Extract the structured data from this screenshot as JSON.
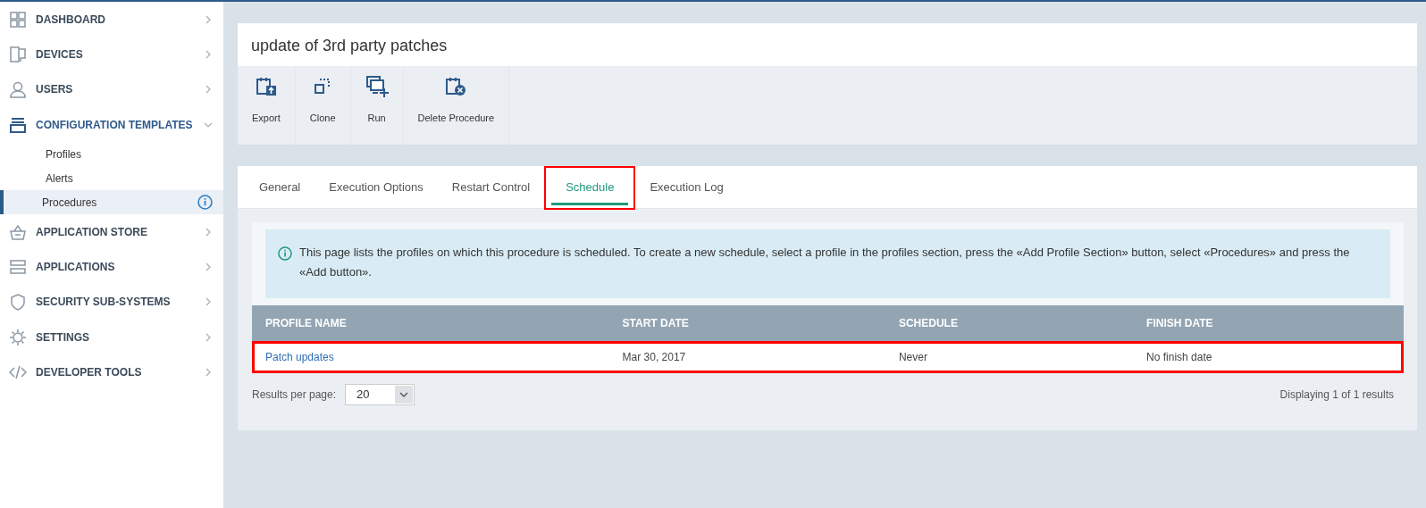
{
  "sidebar": {
    "items": [
      {
        "label": "DASHBOARD",
        "kind": "grid",
        "expanded": false
      },
      {
        "label": "DEVICES",
        "kind": "devices",
        "expanded": false
      },
      {
        "label": "USERS",
        "kind": "user",
        "expanded": false
      },
      {
        "label": "CONFIGURATION TEMPLATES",
        "kind": "templates",
        "expanded": true,
        "children": [
          {
            "label": "Profiles",
            "selected": false
          },
          {
            "label": "Alerts",
            "selected": false
          },
          {
            "label": "Procedures",
            "selected": true
          }
        ]
      },
      {
        "label": "APPLICATION STORE",
        "kind": "basket",
        "expanded": false
      },
      {
        "label": "APPLICATIONS",
        "kind": "apps",
        "expanded": false
      },
      {
        "label": "SECURITY SUB-SYSTEMS",
        "kind": "shield",
        "expanded": false
      },
      {
        "label": "SETTINGS",
        "kind": "gear",
        "expanded": false
      },
      {
        "label": "DEVELOPER TOOLS",
        "kind": "code",
        "expanded": false
      }
    ]
  },
  "page_title": "update of 3rd party patches",
  "toolbar": [
    {
      "label": "Export",
      "kind": "export"
    },
    {
      "label": "Clone",
      "kind": "clone"
    },
    {
      "label": "Run",
      "kind": "run"
    },
    {
      "label": "Delete Procedure",
      "kind": "delete"
    }
  ],
  "tabs": [
    {
      "label": "General",
      "selected": false,
      "highlighted": false
    },
    {
      "label": "Execution Options",
      "selected": false,
      "highlighted": false
    },
    {
      "label": "Restart Control",
      "selected": false,
      "highlighted": false
    },
    {
      "label": "Schedule",
      "selected": true,
      "highlighted": true
    },
    {
      "label": "Execution Log",
      "selected": false,
      "highlighted": false
    }
  ],
  "info_message": "This page lists the profiles on which this procedure is scheduled. To create a new schedule, select a profile in the profiles section, press the «Add Profile Section» button, select «Procedures» and press the «Add button».",
  "table": {
    "columns": [
      "PROFILE NAME",
      "START DATE",
      "SCHEDULE",
      "FINISH DATE"
    ],
    "rows": [
      {
        "highlighted": true,
        "cells": [
          "Patch updates",
          "Mar 30, 2017",
          "Never",
          "No finish date"
        ]
      }
    ]
  },
  "pagination": {
    "label": "Results per page:",
    "value": "20",
    "summary": "Displaying 1 of 1 results"
  }
}
